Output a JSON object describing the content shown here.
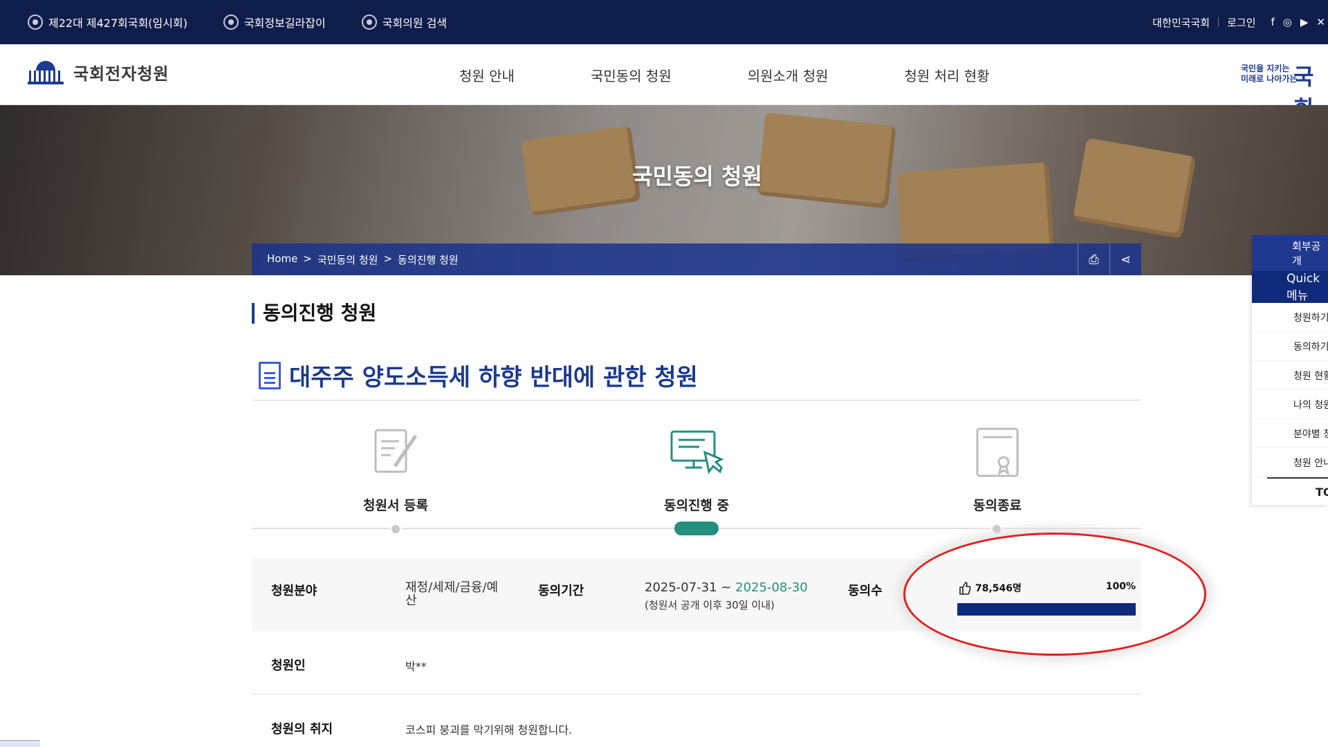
{
  "topbar": {
    "links": [
      "제22대 제427회국회(임시회)",
      "국회정보길라잡이",
      "국회의원 검색"
    ],
    "right": [
      "대한민국국회",
      "로그인"
    ],
    "sns": [
      "facebook-icon",
      "instagram-icon",
      "youtube-icon",
      "x-icon"
    ]
  },
  "header": {
    "logo_text": "국회전자청원",
    "nav": [
      "청원 안내",
      "국민동의 청원",
      "의원소개 청원",
      "청원 처리 현황"
    ],
    "slogan_line1": "국민을 지키는",
    "slogan_line2": "미래로 나아가는",
    "slogan_big": "국회"
  },
  "hero": {
    "title": "국민동의 청원",
    "breadcrumb": [
      "Home",
      ">",
      "국민동의 청원",
      ">",
      "동의진행 청원"
    ]
  },
  "quick_menu": {
    "header1": "회부공개",
    "header2": "Quick 메뉴",
    "items": [
      "청원하기",
      "동의하기",
      "청원 현황",
      "나의 청원",
      "분야별 청원",
      "청원 안내"
    ],
    "top": "TOP"
  },
  "page": {
    "heading": "동의진행 청원",
    "petition_title": "대주주 양도소득세 하향 반대에 관한 청원"
  },
  "steps": [
    {
      "label": "청원서 등록",
      "state": "done"
    },
    {
      "label": "동의진행 중",
      "state": "active"
    },
    {
      "label": "동의종료",
      "state": "pending"
    }
  ],
  "info": {
    "field_label": "청원분야",
    "field_value_line1": "재정/세제/금융/예",
    "field_value_line2": "산",
    "period_label": "동의기간",
    "period_start": "2025-07-31 ~",
    "period_end": "2025-08-30",
    "period_note": "(청원서 공개 이후 30일 이내)",
    "votes_label": "동의수",
    "votes_count": "78,546명",
    "votes_percent": "100%",
    "votes_fraction": 1.0
  },
  "details": {
    "petitioner_label": "청원인",
    "petitioner_value": "박**",
    "purpose_label": "청원의 취지",
    "purpose_value": "코스피 붕괴를 막기위해 청원합니다."
  },
  "colors": {
    "navy": "#0f1d4a",
    "brand_blue": "#1d3b8f",
    "teal": "#23907f",
    "progress": "#0f2a7a",
    "annotation": "#e02020"
  }
}
